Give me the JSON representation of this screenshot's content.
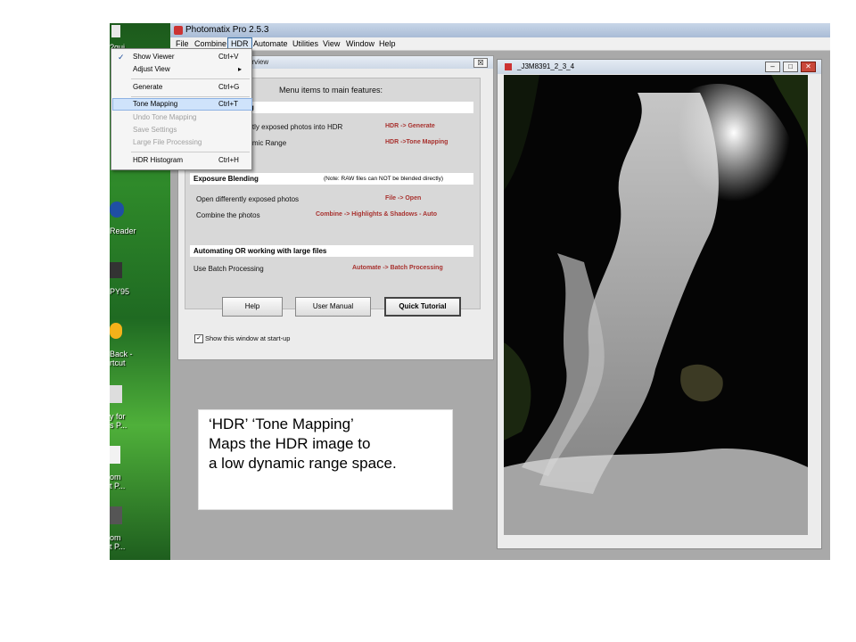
{
  "desktop": {
    "icons": [
      {
        "name": "folder-icon",
        "label": "?gui"
      },
      {
        "name": "reader-icon",
        "label": "Reader"
      },
      {
        "name": "program-icon",
        "label": "PY95"
      },
      {
        "name": "shortcut-icon",
        "label": "Back -\nrtcut"
      },
      {
        "name": "printer-icon",
        "label": "y for\ns P..."
      },
      {
        "name": "document-icon",
        "label": "om\nt P..."
      },
      {
        "name": "document2-icon",
        "label": "om\nt P..."
      }
    ]
  },
  "app": {
    "title": "Photomatix Pro 2.5.3",
    "menus": [
      "File",
      "Combine",
      "HDR",
      "Automate",
      "Utilities",
      "View",
      "Window",
      "Help"
    ],
    "active_menu": "HDR"
  },
  "hdr_menu": {
    "items": [
      {
        "label": "Show Viewer",
        "shortcut": "Ctrl+V",
        "checked": true,
        "disabled": false
      },
      {
        "label": "Adjust View",
        "shortcut": "▸",
        "checked": false,
        "disabled": false
      },
      {
        "label": "Generate",
        "shortcut": "Ctrl+G",
        "checked": false,
        "disabled": false
      },
      {
        "label": "Tone Mapping",
        "shortcut": "Ctrl+T",
        "checked": false,
        "disabled": false,
        "highlighted": true
      },
      {
        "label": "Undo Tone Mapping",
        "shortcut": "",
        "checked": false,
        "disabled": true
      },
      {
        "label": "Save Settings",
        "shortcut": "",
        "checked": false,
        "disabled": true
      },
      {
        "label": "Large File Processing",
        "shortcut": "",
        "checked": false,
        "disabled": true
      },
      {
        "label": "HDR Histogram",
        "shortcut": "Ctrl+H",
        "checked": false,
        "disabled": false
      }
    ]
  },
  "overview": {
    "title": "erview",
    "close": "☒",
    "heading": "Menu items to main features:",
    "section1": {
      "title": "pping"
    },
    "rows1": [
      {
        "label": "ently exposed photos into HDR",
        "path": "HDR -> Generate"
      },
      {
        "label": "namic Range",
        "path": "HDR ->Tone Mapping"
      }
    ],
    "section2": {
      "title": "Exposure Blending",
      "note": "(Note: RAW files can NOT be blended directly)"
    },
    "rows2": [
      {
        "label": "Open differently exposed photos",
        "path": "File -> Open"
      },
      {
        "label": "Combine the photos",
        "path": "Combine -> Highlights & Shadows - Auto"
      }
    ],
    "section3": {
      "title": "Automating OR working with large files"
    },
    "rows3": [
      {
        "label": "Use Batch Processing",
        "path": "Automate -> Batch Processing"
      }
    ],
    "buttons": {
      "help": "Help",
      "manual": "User Manual",
      "tutorial": "Quick Tutorial"
    },
    "startup_label": "Show this window at start-up",
    "startup_checked": true
  },
  "image_window": {
    "title": "_J3M8391_2_3_4",
    "min": "–",
    "max": "□",
    "close": "✕"
  },
  "caption": {
    "line1": "‘HDR’ ‘Tone Mapping’",
    "line2": "Maps the HDR image to",
    "line3": "a low dynamic range space."
  }
}
